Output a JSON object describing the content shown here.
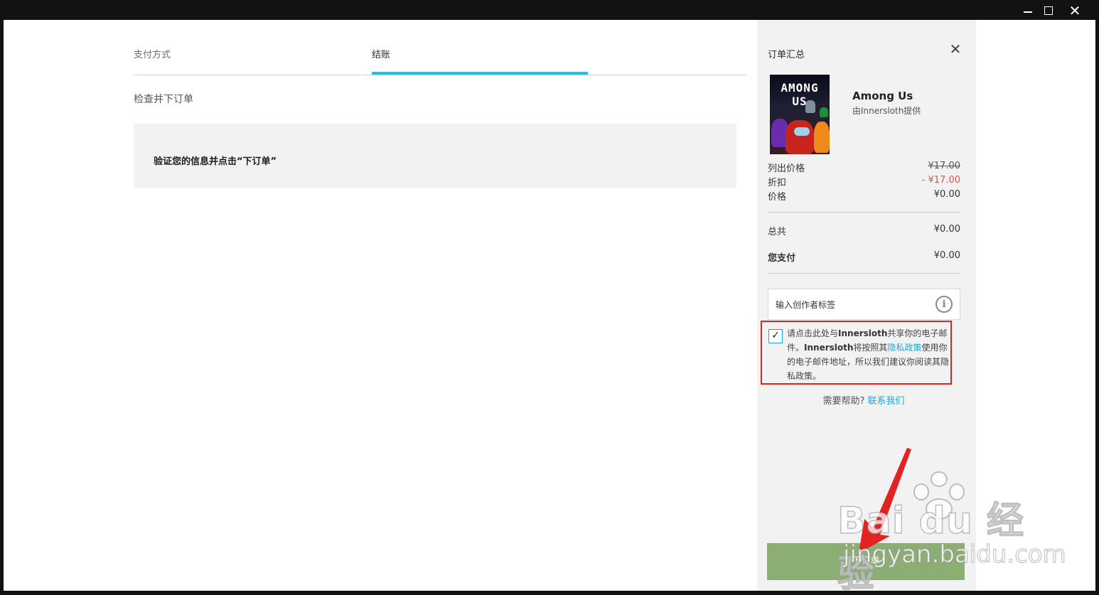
{
  "window": {
    "minimize_icon": "minimize-icon",
    "maximize_icon": "maximize-icon",
    "close_glyph": "✕"
  },
  "checkout": {
    "tabs": [
      {
        "label": "支付方式",
        "active": false
      },
      {
        "label": "结账",
        "active": true
      }
    ],
    "section_title": "检查并下订单",
    "notice": "验证您的信息并点击“下订单”"
  },
  "summary": {
    "title": "订单汇总",
    "close_glyph": "✕",
    "game": {
      "cover_title": "AMONG US",
      "name": "Among Us",
      "publisher": "由Innersloth提供"
    },
    "rows": {
      "list_price": {
        "label": "列出价格",
        "value": "¥17.00"
      },
      "discount": {
        "label": "折扣",
        "value": "- ¥17.00"
      },
      "price": {
        "label": "价格",
        "value": "¥0.00"
      },
      "total": {
        "label": "总共",
        "value": "¥0.00"
      },
      "you_pay": {
        "label": "您支付",
        "value": "¥0.00"
      }
    },
    "creator_tag_placeholder": "输入创作者标签",
    "info_glyph": "i",
    "consent": {
      "checked": true,
      "check_glyph": "✓",
      "part1": "请点击此处与",
      "brand1": "Innersloth",
      "part2": "共享你的电子邮件。",
      "brand2": "Innersloth",
      "part3": "将按照其",
      "policy_link": "隐私政策",
      "part4": "使用你的电子邮件地址，所以我们建议你阅读其隐私政策。"
    },
    "help": {
      "question": "需要帮助?",
      "link": "联系我们"
    },
    "order_button": "下订单"
  },
  "watermark": {
    "logo": "Bai  du 经验",
    "url": "jingyan.baidu.com"
  },
  "colors": {
    "accent": "#26bbe8",
    "link": "#1ea7d6",
    "discount": "#d9534f",
    "highlight_border": "#e02424",
    "order_button": "#8cae75",
    "summary_bg": "#f2f2f2"
  }
}
